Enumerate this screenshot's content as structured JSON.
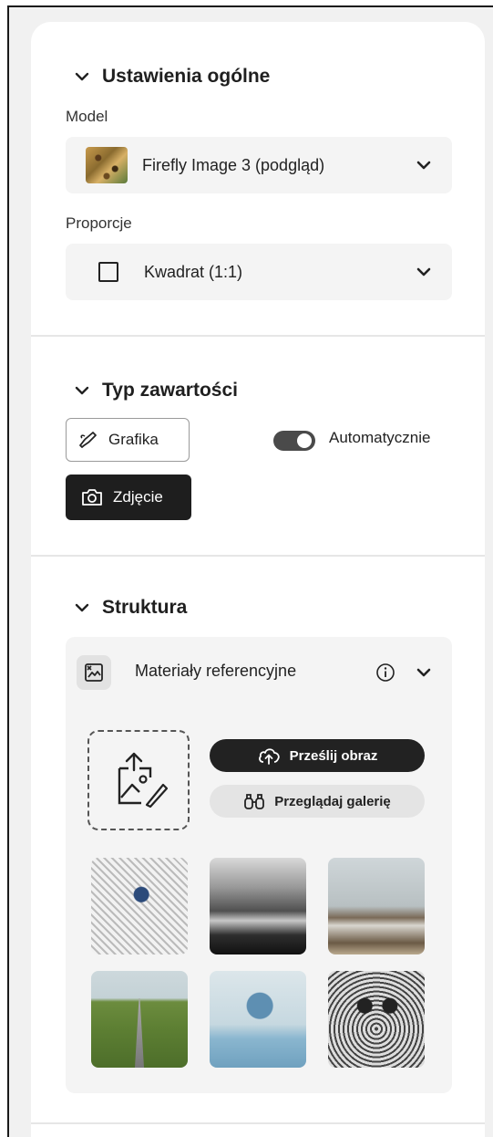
{
  "general": {
    "title": "Ustawienia ogólne",
    "model_label": "Model",
    "model_value": "Firefly Image 3 (podgląd)",
    "aspect_label": "Proporcje",
    "aspect_value": "Kwadrat (1:1)"
  },
  "content_type": {
    "title": "Typ zawartości",
    "graphic_label": "Grafika",
    "photo_label": "Zdjęcie",
    "auto_label": "Automatycznie",
    "auto_enabled": true
  },
  "structure": {
    "title": "Struktura",
    "reference_label": "Materiały referencyjne",
    "upload_label": "Prześlij obraz",
    "browse_label": "Przeglądaj galerię",
    "gallery": [
      "bird-sketch-image",
      "misty-river-image",
      "living-room-image",
      "field-road-image",
      "sphere-cube-image",
      "owl-sketch-image"
    ]
  },
  "colors": {
    "dark_button": "#1e1e1e",
    "toggle_on": "#4a4a4a",
    "card_bg": "#f4f4f4"
  }
}
